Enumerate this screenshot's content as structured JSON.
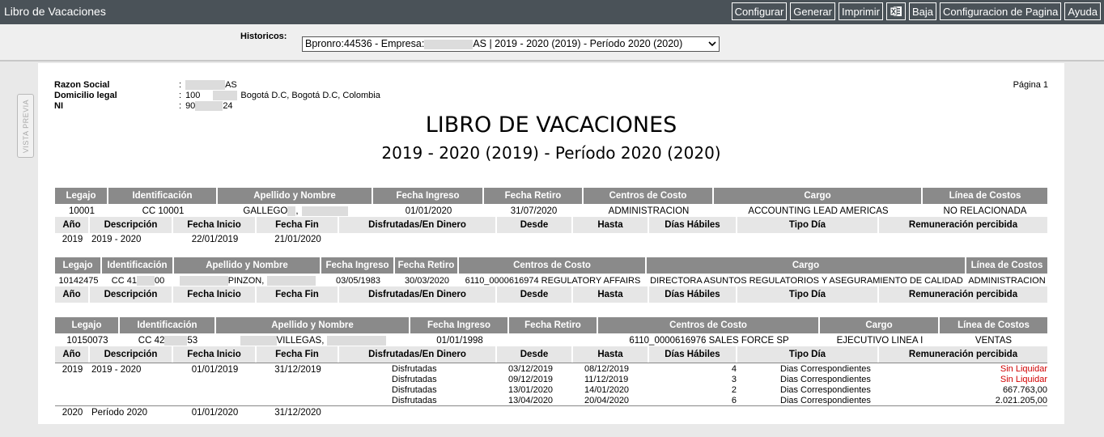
{
  "app": {
    "title": "Libro de Vacaciones"
  },
  "toolbar": {
    "configurar": "Configurar",
    "generar": "Generar",
    "imprimir": "Imprimir",
    "excel_icon": "excel-icon",
    "baja": "Baja",
    "config_pagina": "Configuracion de Pagina",
    "ayuda": "Ayuda"
  },
  "filter": {
    "label": "Historicos:",
    "select_prefix": "Bpronro:44536 - Empresa:",
    "select_suffix": "AS | 2019 - 2020 (2019) - Período 2020 (2020)"
  },
  "preview_tab": "VISTA PREVIA",
  "company": {
    "razon_label": "Razon Social",
    "razon_value": "AS",
    "domicilio_label": "Domicilio legal",
    "domicilio_num": "100",
    "domicilio_city": "Bogotá D.C, Bogotá D.C, Colombia",
    "ni_label": "NI",
    "ni_prefix": "90",
    "ni_suffix": "24",
    "colon": ":"
  },
  "page_label": "Página 1",
  "doc": {
    "title": "LIBRO DE VACACIONES",
    "subtitle": "2019 - 2020 (2019) - Período 2020 (2020)"
  },
  "headers": {
    "legajo": "Legajo",
    "identificacion": "Identificación",
    "apellido": "Apellido y Nombre",
    "fecha_ingreso": "Fecha Ingreso",
    "fecha_retiro": "Fecha Retiro",
    "centros": "Centros de Costo",
    "cargo": "Cargo",
    "linea": "Línea de Costos"
  },
  "subheaders": {
    "anio": "Año",
    "descripcion": "Descripción",
    "fecha_inicio": "Fecha Inicio",
    "fecha_fin": "Fecha Fin",
    "disfrutadas": "Disfrutadas/En Dinero",
    "desde": "Desde",
    "hasta": "Hasta",
    "dias": "Días Hábiles",
    "tipo": "Tipo Día",
    "remuneracion": "Remuneración percibida"
  },
  "employees": [
    {
      "legajo": "10001",
      "ident": "CC 10001",
      "name_a": "GALLEGO",
      "name_b": ",",
      "ingreso": "01/01/2020",
      "retiro": "31/07/2020",
      "centro": "ADMINISTRACION",
      "cargo": "ACCOUNTING LEAD AMERICAS",
      "linea": "NO RELACIONADA",
      "periods": [
        {
          "anio": "2019",
          "desc": "2019 - 2020",
          "inicio": "22/01/2019",
          "fin": "21/01/2020"
        }
      ]
    },
    {
      "legajo": "10142475",
      "ident_a": "CC 41",
      "ident_b": "00",
      "name": "PINZON,",
      "ingreso": "03/05/1983",
      "retiro": "30/03/2020",
      "centro": "6110_0000616974 REGULATORY AFFAIRS",
      "cargo": "DIRECTORA ASUNTOS REGULATORIOS Y ASEGURAMIENTO DE CALIDAD",
      "linea": "ADMINISTRACION"
    },
    {
      "legajo": "10150073",
      "ident_a": "CC 42",
      "ident_b": "53",
      "name": "VILLEGAS,",
      "ingreso": "01/01/1998",
      "retiro": "",
      "centro": "6110_0000616976 SALES FORCE SP",
      "cargo": "EJECUTIVO LINEA I",
      "linea": "VENTAS",
      "periods": [
        {
          "anio": "2019",
          "desc": "2019 - 2020",
          "inicio": "01/01/2019",
          "fin": "31/12/2019"
        },
        {
          "anio": "2020",
          "desc": "Período 2020",
          "inicio": "01/01/2020",
          "fin": "31/12/2020"
        }
      ],
      "details": [
        {
          "tipo": "Disfrutadas",
          "desde": "03/12/2019",
          "hasta": "08/12/2019",
          "dias": "4",
          "dia": "Dias Correspondientes",
          "rem": "Sin Liquidar"
        },
        {
          "tipo": "Disfrutadas",
          "desde": "09/12/2019",
          "hasta": "11/12/2019",
          "dias": "3",
          "dia": "Dias Correspondientes",
          "rem": "Sin Liquidar"
        },
        {
          "tipo": "Disfrutadas",
          "desde": "13/01/2020",
          "hasta": "14/01/2020",
          "dias": "2",
          "dia": "Dias Correspondientes",
          "rem": "667.763,00"
        },
        {
          "tipo": "Disfrutadas",
          "desde": "13/04/2020",
          "hasta": "20/04/2020",
          "dias": "6",
          "dia": "Dias Correspondientes",
          "rem": "2.021.205,00"
        }
      ]
    }
  ],
  "colors": {
    "topbar": "#4a5258",
    "header": "#8a8a8a",
    "subheader": "#e6e6e6",
    "sin_liquidar": "#d00000"
  }
}
